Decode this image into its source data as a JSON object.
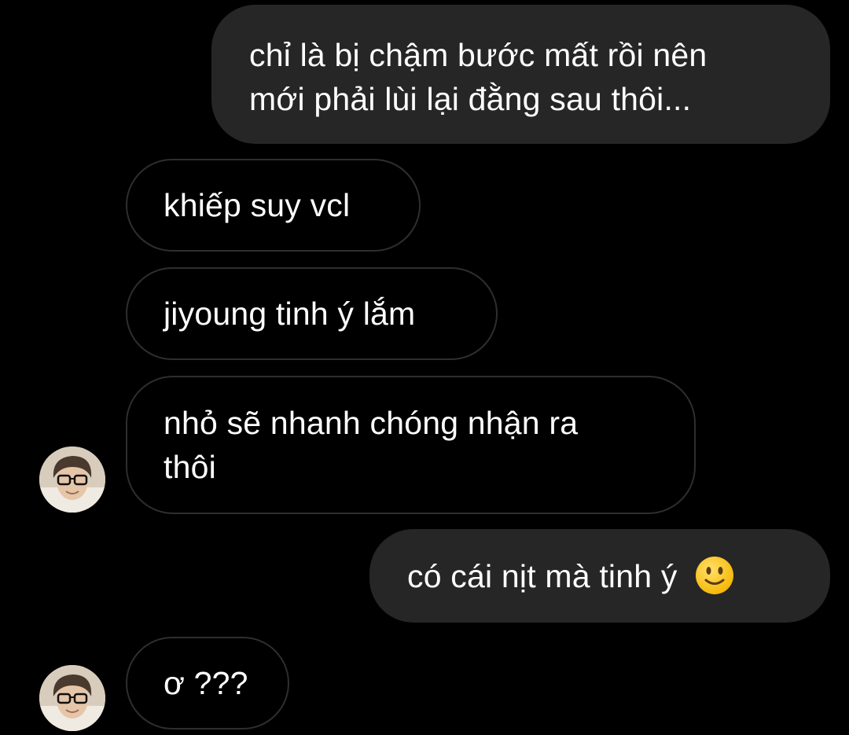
{
  "conversation": {
    "messages": [
      {
        "sender": "me",
        "lines": [
          "chỉ là bị chậm bước mất rồi nên",
          "mới phải lùi lại đằng sau thôi..."
        ]
      },
      {
        "sender": "them",
        "lines": [
          "khiếp suy vcl"
        ]
      },
      {
        "sender": "them",
        "lines": [
          "jiyoung tinh ý lắm"
        ]
      },
      {
        "sender": "them",
        "lines": [
          "nhỏ sẽ nhanh chóng nhận ra",
          "thôi"
        ]
      },
      {
        "sender": "me",
        "lines": [
          "có cái nịt mà tinh ý"
        ],
        "emoji": "slightly-smiling-face-icon"
      },
      {
        "sender": "them",
        "lines": [
          "ơ ???"
        ]
      }
    ]
  },
  "colors": {
    "background": "#000000",
    "outgoing_bubble": "#262626",
    "incoming_border": "#2e2e2e",
    "text": "#ffffff"
  }
}
